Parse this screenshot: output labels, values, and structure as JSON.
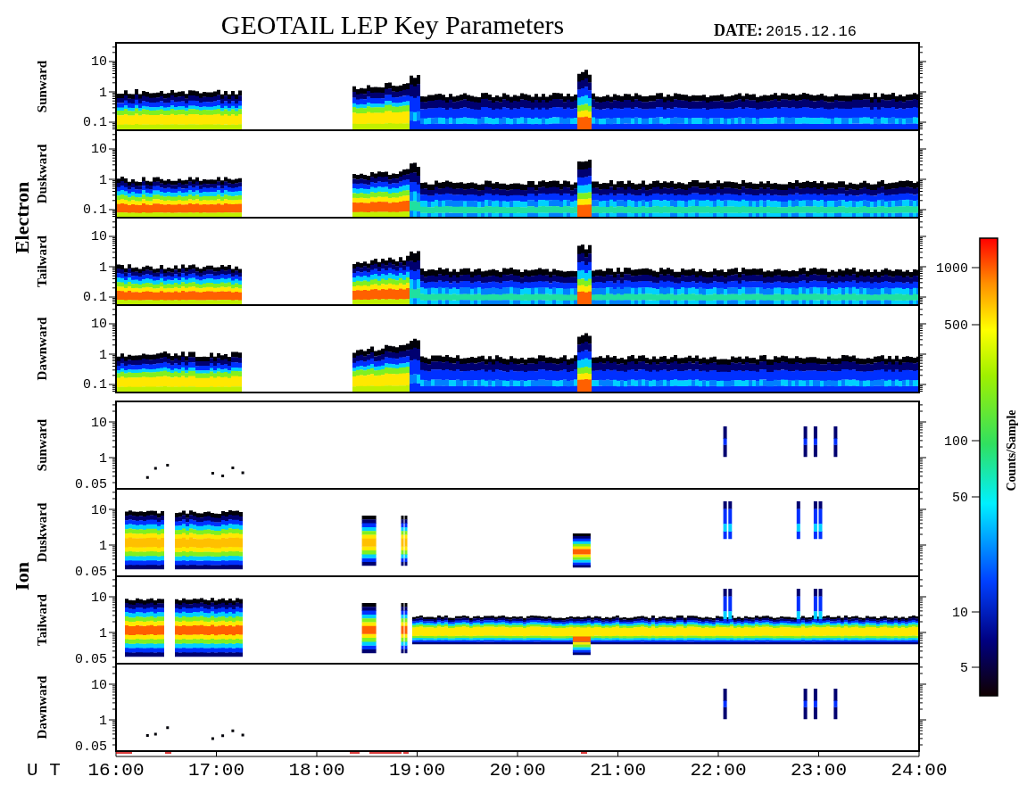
{
  "title": "GEOTAIL LEP Key Parameters",
  "date": {
    "label": "DATE:",
    "value": "2015.12.16"
  },
  "groups": [
    {
      "kind": "electron",
      "name": "Electron",
      "panels": [
        {
          "direction": "Sunward",
          "yticks": [
            "10",
            "1",
            "0.1"
          ]
        },
        {
          "direction": "Duskward",
          "yticks": [
            "10",
            "1",
            "0.1"
          ]
        },
        {
          "direction": "Tailward",
          "yticks": [
            "10",
            "1",
            "0.1"
          ]
        },
        {
          "direction": "Dawnward",
          "yticks": [
            "10",
            "1",
            "0.1"
          ]
        }
      ]
    },
    {
      "kind": "ion",
      "name": "Ion",
      "panels": [
        {
          "direction": "Sunward",
          "yticks": [
            "10",
            "1",
            "0.05"
          ]
        },
        {
          "direction": "Duskward",
          "yticks": [
            "10",
            "1",
            "0.05"
          ]
        },
        {
          "direction": "Tailward",
          "yticks": [
            "10",
            "1",
            "0.05"
          ]
        },
        {
          "direction": "Dawnward",
          "yticks": [
            "10",
            "1",
            "0.05"
          ]
        }
      ]
    }
  ],
  "time_axis": {
    "label": "U T",
    "ticks": [
      "16:00",
      "17:00",
      "18:00",
      "19:00",
      "20:00",
      "21:00",
      "22:00",
      "23:00",
      "24:00"
    ]
  },
  "colorbar": {
    "label": "Counts/Sample",
    "ticks": [
      "1000",
      "500",
      "100",
      "50",
      "10",
      "5"
    ]
  }
}
